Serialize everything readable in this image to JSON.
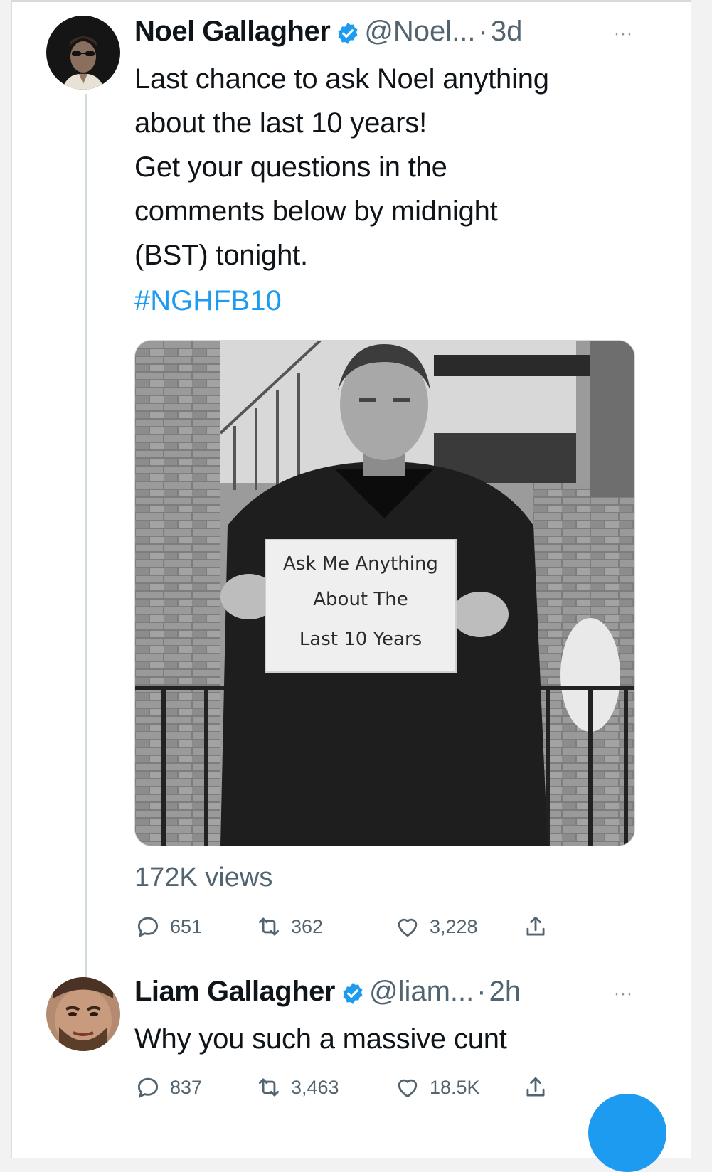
{
  "tweets": [
    {
      "author": "Noel Gallagher",
      "handle": "@Noel...",
      "separator": "·",
      "time": "3d",
      "more": "···",
      "text": "Last chance to ask Noel anything\nabout the last 10 years!\nGet your questions in the\ncomments below by midnight\n(BST) tonight.",
      "hashtag": "#NGHFB10",
      "media": {
        "sign_lines": [
          "Ask Me Anything",
          "About The",
          "Last 10 Years"
        ]
      },
      "views": "172K views",
      "stats": {
        "replies": "651",
        "retweets": "362",
        "likes": "3,228"
      }
    },
    {
      "author": "Liam Gallagher",
      "handle": "@liam...",
      "separator": "·",
      "time": "2h",
      "more": "···",
      "text": "Why you such a massive cunt",
      "stats": {
        "replies": "837",
        "retweets": "3,463",
        "likes": "18.5K"
      }
    }
  ],
  "icons": {
    "verified": "verified-badge-icon",
    "reply": "reply-icon",
    "retweet": "retweet-icon",
    "like": "heart-icon",
    "share": "share-icon"
  },
  "colors": {
    "accent": "#1d9bf0",
    "muted": "#536471",
    "thread": "#cfd9de"
  }
}
